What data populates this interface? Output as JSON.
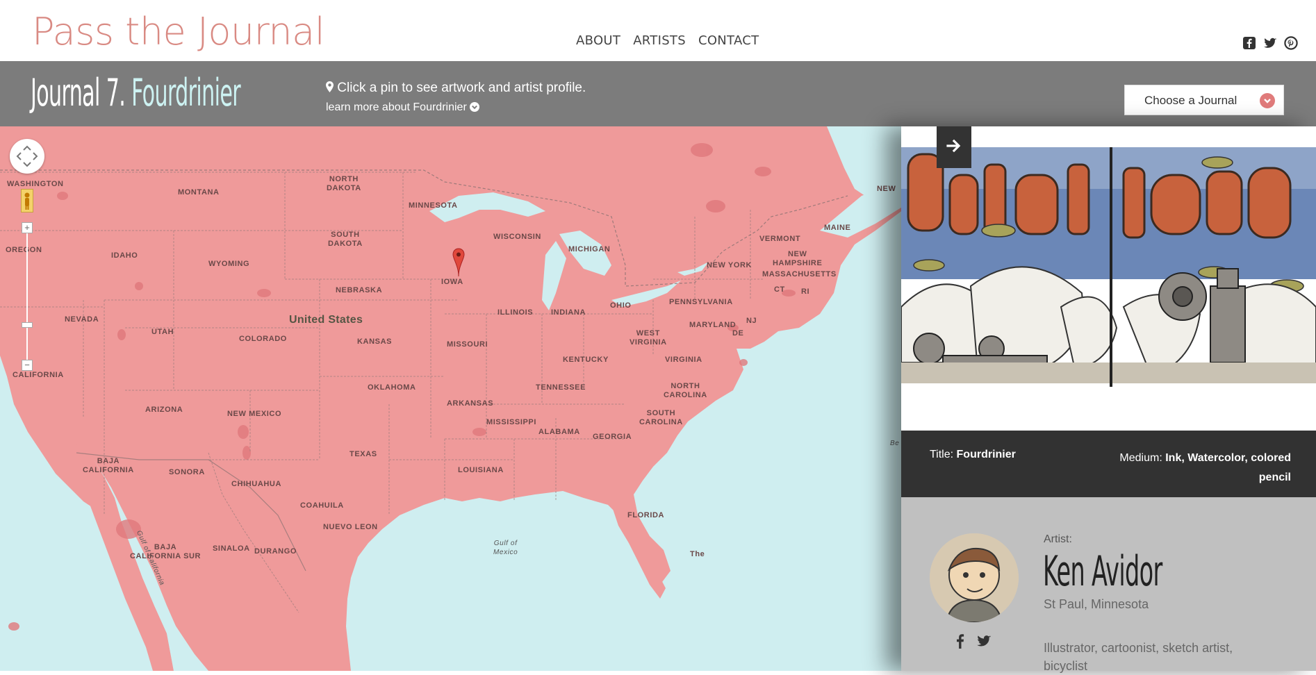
{
  "site": {
    "logo": "Pass the Journal"
  },
  "nav": {
    "items": [
      "ABOUT",
      "ARTISTS",
      "CONTACT"
    ]
  },
  "social_top": [
    "facebook-icon",
    "twitter-icon",
    "pinterest-icon"
  ],
  "subheader": {
    "journal_prefix": "Journal 7.",
    "journal_name": "Fourdrinier",
    "instruction": "Click a pin to see artwork and artist profile.",
    "learn_more": "learn more about Fourdrinier",
    "select_label": "Choose a Journal"
  },
  "map": {
    "labels": {
      "washington": "WASHINGTON",
      "montana": "MONTANA",
      "north_dakota": "NORTH\nDAKOTA",
      "minnesota": "MINNESOTA",
      "south_dakota": "SOUTH\nDAKOTA",
      "wisconsin": "WISCONSIN",
      "michigan": "MICHIGAN",
      "oregon": "OREGON",
      "idaho": "IDAHO",
      "wyoming": "WYOMING",
      "iowa": "IOWA",
      "nebraska": "NEBRASKA",
      "nevada": "NEVADA",
      "utah": "UTAH",
      "colorado": "COLORADO",
      "kansas": "KANSAS",
      "united_states": "United States",
      "illinois": "ILLINOIS",
      "indiana": "INDIANA",
      "ohio": "OHIO",
      "missouri": "MISSOURI",
      "pennsylvania": "PENNSYLVANIA",
      "new_york": "NEW YORK",
      "vermont": "VERMONT",
      "maine": "MAINE",
      "new_hampshire": "NEW\nHAMPSHIRE",
      "massachusetts": "MASSACHUSETTS",
      "ct": "CT",
      "ri": "RI",
      "maryland": "MARYLAND",
      "nj": "NJ",
      "de": "DE",
      "west_virginia": "WEST\nVIRGINIA",
      "kentucky": "KENTUCKY",
      "virginia": "VIRGINIA",
      "california": "CALIFORNIA",
      "oklahoma": "OKLAHOMA",
      "tennessee": "TENNESSEE",
      "north_carolina": "NORTH\nCAROLINA",
      "arizona": "ARIZONA",
      "new_mexico": "NEW MEXICO",
      "arkansas": "ARKANSAS",
      "south_carolina": "SOUTH\nCAROLINA",
      "mississippi": "MISSISSIPPI",
      "alabama": "ALABAMA",
      "georgia": "GEORGIA",
      "texas": "TEXAS",
      "louisiana": "LOUISIANA",
      "baja_california": "BAJA\nCALIFORNIA",
      "sonora": "SONORA",
      "chihuahua": "CHIHUAHUA",
      "coahuila": "COAHUILA",
      "nuevo_leon": "NUEVO LEON",
      "florida": "FLORIDA",
      "gulf_california": "Gulf of California",
      "gulf_mexico": "Gulf of\nMexico",
      "baja_sur": "BAJA\nCALIFORNIA SUR",
      "sinaloa": "SINALOA",
      "durango": "DURANGO",
      "new": "NEW",
      "be": "Be",
      "the": "The"
    }
  },
  "artwork": {
    "title_label": "Title:",
    "title_value": "Fourdrinier",
    "medium_label": "Medium:",
    "medium_value": "Ink, Watercolor, colored pencil"
  },
  "artist": {
    "label": "Artist:",
    "name": "Ken Avidor",
    "location": "St Paul, Minnesota",
    "bio": "Illustrator, cartoonist, sketch artist, bicyclist",
    "social": [
      "facebook-icon",
      "twitter-icon"
    ]
  },
  "colors": {
    "land": "#ef9a9a",
    "water": "#cfeef0",
    "band": "#7c7c7c",
    "accent": "#d98a83"
  }
}
